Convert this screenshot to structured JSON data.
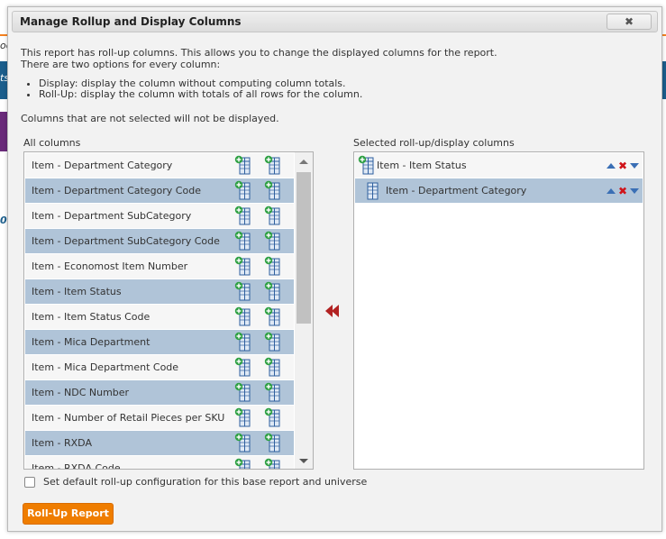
{
  "background": {
    "snippet_top": "oo",
    "snippet_mid": "ts",
    "snippet_low": "0"
  },
  "dialog": {
    "title": "Manage Rollup and Display Columns",
    "close_icon": "close-icon",
    "intro_line1": "This report has roll-up columns. This allows you to change the displayed columns for the report.",
    "intro_line2": "There are two options for every column:",
    "bullet_display": "Display: display the column without computing column totals.",
    "bullet_rollup": "Roll-Up: display the column with totals of all rows for the column.",
    "note": "Columns that are not selected will not be displayed.",
    "all_columns_label": "All columns",
    "selected_label": "Selected roll-up/display columns",
    "all_columns": [
      "Item - Department Category",
      "Item - Department Category Code",
      "Item - Department SubCategory",
      "Item - Department SubCategory Code",
      "Item - Economost Item Number",
      "Item - Item Status",
      "Item - Item Status Code",
      "Item - Mica Department",
      "Item - Mica Department Code",
      "Item - NDC Number",
      "Item - Number of Retail Pieces per SKU",
      "Item - RXDA",
      "Item - RXDA Code"
    ],
    "selected_columns": [
      "Item - Item Status",
      "Item - Department Category"
    ],
    "default_checkbox_label": "Set default roll-up configuration for this base report and universe",
    "default_checked": false,
    "rollup_button": "Roll-Up Report",
    "colors": {
      "accent": "#ef7d00",
      "row_alt": "#b0c4d8",
      "move_arrow": "#b22222",
      "sort_arrow": "#3a6fb5",
      "remove_x": "#d0141a"
    }
  }
}
